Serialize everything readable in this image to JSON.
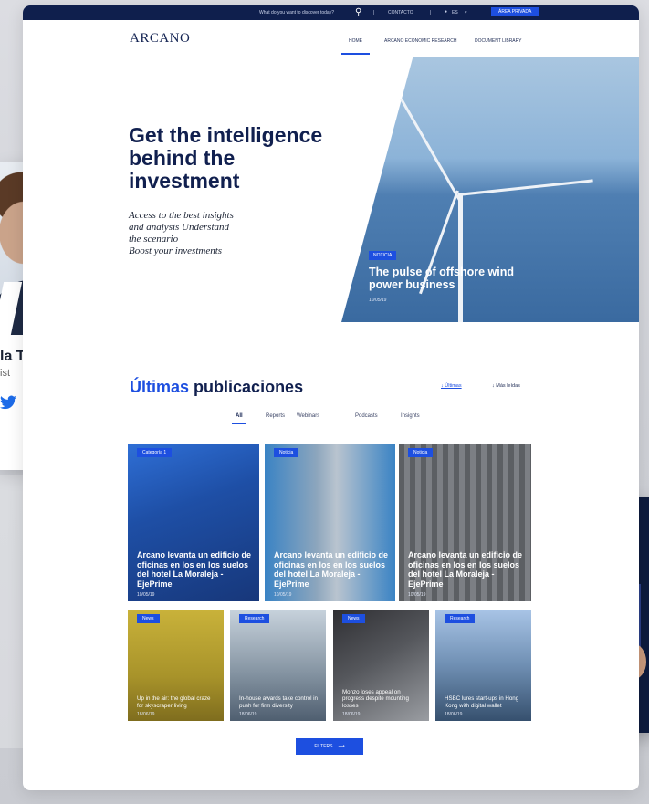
{
  "topbar": {
    "search_placeholder": "What do you want to discover today?",
    "contact": "CONTACTO",
    "language": "ES",
    "private_area": "ÁREA PRIVADA"
  },
  "nav": {
    "logo": "ARCANO",
    "items": [
      "HOME",
      "ARCANO ECONOMIC RESEARCH",
      "DOCUMENT LIBRARY"
    ]
  },
  "hero": {
    "title": "Get the intelligence behind the investment",
    "subtitle": "Access to the best insights\nand analysis Understand\nthe scenario\nBoost your investments",
    "badge": "NOTICIA",
    "caption": "The pulse of offshore wind power business",
    "date": "10/05/19"
  },
  "publications": {
    "title_highlight": "Últimas",
    "title_rest": "publicaciones",
    "sort": [
      "Últimas",
      "Más leídas"
    ],
    "tabs": [
      "All",
      "Reports",
      "Webinars",
      "Podcasts",
      "Insights"
    ],
    "large_cards": [
      {
        "badge": "Categoría 1",
        "title": "Arcano levanta un edificio de oficinas en los en los suelos del hotel La Moraleja - EjePrime",
        "date": "10/05/19"
      },
      {
        "badge": "Noticia",
        "title": "Arcano levanta un edificio de oficinas en los en los suelos del hotel La Moraleja - EjePrime",
        "date": "10/05/19"
      },
      {
        "badge": "Noticia",
        "title": "Arcano levanta un edificio de oficinas en los en los suelos del hotel La Moraleja - EjePrime",
        "date": "10/05/19"
      }
    ],
    "small_cards": [
      {
        "badge": "News",
        "title": "Up in the air: the global craze for skyscraper living",
        "date": "18/06/19"
      },
      {
        "badge": "Research",
        "title": "In-house awards take control in push for firm diversity",
        "date": "18/06/19"
      },
      {
        "badge": "News",
        "title": "Monzo loses appeal on progress despite mounting losses",
        "date": "18/06/19"
      },
      {
        "badge": "Research",
        "title": "HSBC lures start-ups in Hong Kong with digital wallet",
        "date": "18/06/19"
      }
    ],
    "filters_label": "FILTERS"
  },
  "profile": {
    "name": "la Torre",
    "role": "ist"
  }
}
